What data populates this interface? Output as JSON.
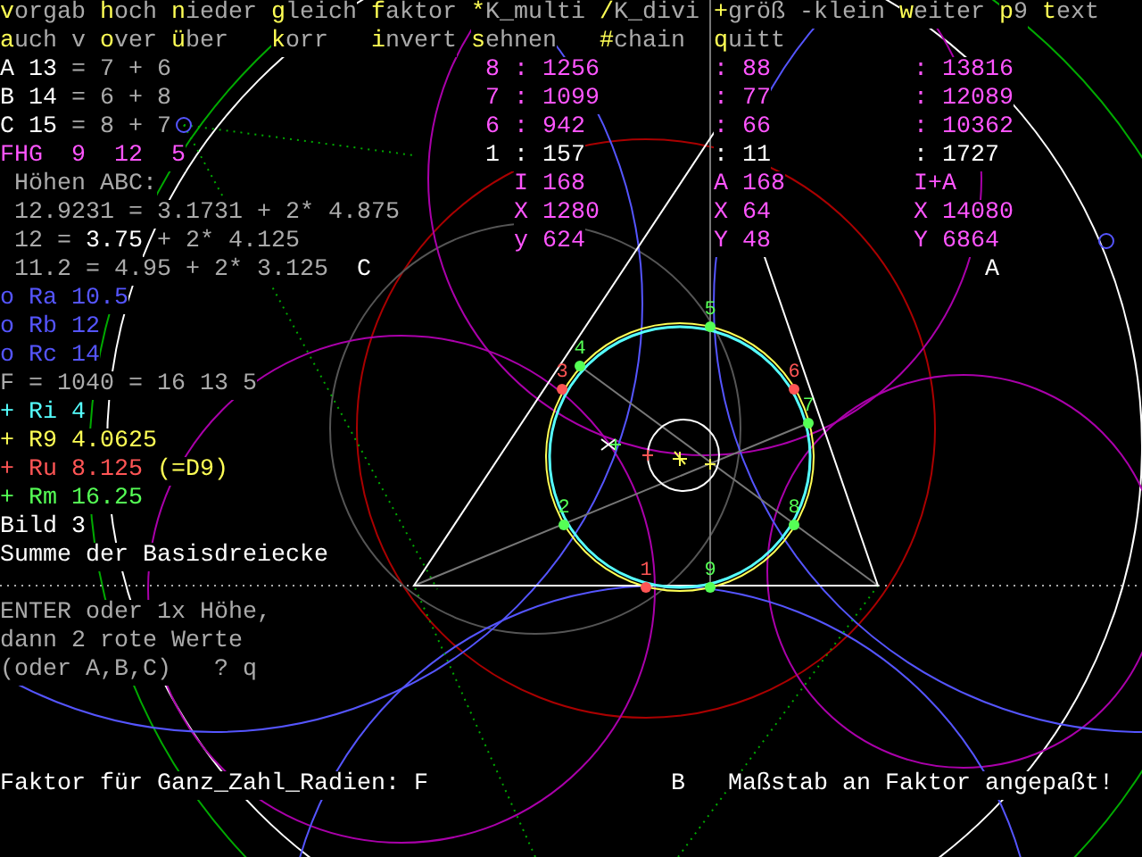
{
  "menu": [
    [
      {
        "key": "v",
        "rest": "orgab"
      },
      {
        "key": "h",
        "rest": "och"
      },
      {
        "key": "n",
        "rest": "ieder"
      },
      {
        "key": "g",
        "rest": "leich"
      },
      {
        "key": "f",
        "rest": "aktor"
      },
      {
        "key": "*",
        "rest": "K_multi"
      },
      {
        "key": "/",
        "rest": "K_divi"
      },
      {
        "key": "+",
        "rest": "größ"
      },
      {
        "rest": "-klein"
      },
      {
        "key": "w",
        "rest": "eiter"
      },
      {
        "key": "p",
        "rest": "9"
      },
      {
        "key": "t",
        "rest": "ext"
      }
    ],
    [
      {
        "key": "a",
        "rest": "uch"
      },
      {
        "rest": "v"
      },
      {
        "key": "o",
        "rest": "ver"
      },
      {
        "key": "ü",
        "rest": "ber"
      },
      {
        "key": "k",
        "rest": "orr"
      },
      {
        "key": "i",
        "rest": "nvert"
      },
      {
        "key": "s",
        "rest": "ehnen"
      },
      {
        "key": "#",
        "rest": "chain"
      },
      {
        "key": "q",
        "rest": "uitt"
      }
    ]
  ],
  "sides": [
    [
      {
        "text": "A 13",
        "color": "#ffffff"
      },
      {
        "text": "= 7 + 6",
        "color": "#aaaaaa"
      }
    ],
    [
      {
        "text": "B 14",
        "color": "#ffffff"
      },
      {
        "text": "= 6 + 8",
        "color": "#aaaaaa"
      }
    ],
    [
      {
        "text": "C 15",
        "color": "#ffffff"
      },
      {
        "text": "= 8 + 7",
        "color": "#aaaaaa"
      }
    ]
  ],
  "fhg": [
    [
      {
        "text": "FHG  9  12  5",
        "color": "#ff55ff"
      }
    ]
  ],
  "heights": [
    [
      {
        "text": "Höhen ABC:",
        "color": "#aaaaaa"
      }
    ],
    [
      {
        "text": "12.9231 = 3.1731 + 2* 4.875",
        "color": "#aaaaaa"
      }
    ],
    [
      {
        "text": "12 =",
        "color": "#aaaaaa"
      },
      {
        "text": "3.75",
        "color": "#ffffff"
      },
      {
        "text": "+ 2* 4.125",
        "color": "#aaaaaa"
      }
    ],
    [
      {
        "text": "11.2 = 4.95 + 2* 3.125",
        "color": "#aaaaaa"
      }
    ]
  ],
  "radii": [
    [
      {
        "text": "o Ra 10.5",
        "color": "#5555ff"
      }
    ],
    [
      {
        "text": "o Rb 12",
        "color": "#5555ff"
      }
    ],
    [
      {
        "text": "o Rc 14",
        "color": "#5555ff"
      }
    ],
    [
      {
        "text": "F = 1040 = 16 13 5",
        "color": "#aaaaaa"
      }
    ],
    [
      {
        "text": "+ Ri 4",
        "color": "#55ffff"
      }
    ],
    [
      {
        "text": "+ R9 4.0625",
        "color": "#ffff55"
      }
    ],
    [
      {
        "text": "+ Ru 8.125",
        "color": "#ff5555"
      },
      {
        "text": "(=D9)",
        "color": "#ffff55"
      }
    ],
    [
      {
        "text": "+ Rm 16.25",
        "color": "#55ff55"
      }
    ]
  ],
  "figure": [
    [
      {
        "text": "Bild 3",
        "color": "#ffffff"
      }
    ],
    [
      {
        "text": "Summe der Basisdreiecke",
        "color": "#ffffff"
      }
    ]
  ],
  "prompt": [
    [
      {
        "text": "ENTER oder 1x Höhe,",
        "color": "#aaaaaa"
      }
    ],
    [
      {
        "text": "dann 2 rote Werte",
        "color": "#aaaaaa"
      }
    ],
    [
      {
        "text": "(oder A,B,C)   ? q",
        "color": "#aaaaaa"
      }
    ]
  ],
  "status": [
    [
      {
        "text": "Faktor für Ganz_Zahl_Radien: F",
        "color": "#ffffff"
      }
    ]
  ],
  "scale_note": "Maßstab an Faktor angepaßt!",
  "vertex_labels": [
    "C",
    "A",
    "B"
  ],
  "table": [
    {
      "kind": "ratio",
      "color": "#ff55ff",
      "cells": [
        "8 : 1256",
        ": 88",
        ": 13816"
      ]
    },
    {
      "kind": "ratio",
      "color": "#ff55ff",
      "cells": [
        "7 : 1099",
        ": 77",
        ": 12089"
      ]
    },
    {
      "kind": "ratio",
      "color": "#ff55ff",
      "cells": [
        "6 : 942",
        ": 66",
        ": 10362"
      ]
    },
    {
      "kind": "ratio",
      "color": "#ffffff",
      "cells": [
        "1 : 157",
        ": 11",
        ": 1727"
      ]
    },
    {
      "kind": "coord",
      "color": "#ff55ff",
      "cells": [
        "I 168",
        "A 168",
        "I+A"
      ]
    },
    {
      "kind": "coord",
      "color": "#ff55ff",
      "cells": [
        "X 1280",
        "X 64",
        "X 14080"
      ]
    },
    {
      "kind": "coord",
      "color": "#ff55ff",
      "cells": [
        "y 624",
        "Y 48",
        "Y 6864"
      ]
    }
  ],
  "points": [
    {
      "label": "1",
      "color": "#ff5555"
    },
    {
      "label": "2",
      "color": "#55ff55"
    },
    {
      "label": "3",
      "color": "#ff5555"
    },
    {
      "label": "4",
      "color": "#55ff55"
    },
    {
      "label": "5",
      "color": "#55ff55"
    },
    {
      "label": "6",
      "color": "#ff5555"
    },
    {
      "label": "7",
      "color": "#55ff55"
    },
    {
      "label": "8",
      "color": "#55ff55"
    },
    {
      "label": "9",
      "color": "#55ff55"
    }
  ]
}
